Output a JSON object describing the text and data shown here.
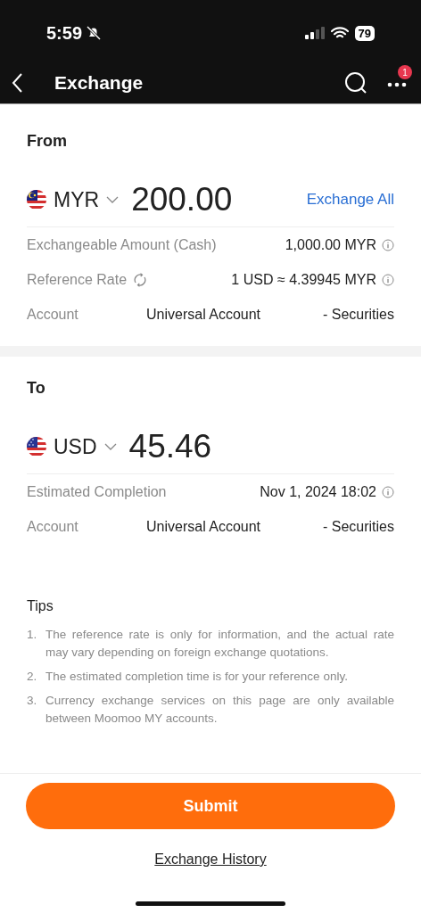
{
  "status_bar": {
    "time": "5:59",
    "battery": "79"
  },
  "nav": {
    "title": "Exchange",
    "badge": "1"
  },
  "sections": [
    {
      "heading": "From",
      "currency": "MYR",
      "kind": "malaysia",
      "amount": "200.00",
      "action": "Exchange All",
      "rows": [
        {
          "kind": "info",
          "label": "Exchangeable Amount (Cash)",
          "value": "1,000.00 MYR",
          "refresh": false,
          "info": true
        },
        {
          "kind": "info",
          "label": "Reference Rate",
          "value": "1 USD ≈ 4.39945 MYR",
          "refresh": true,
          "info": true
        },
        {
          "kind": "account",
          "label": "Account",
          "name": "Universal Account",
          "type": "- Securities"
        }
      ]
    },
    {
      "heading": "To",
      "currency": "USD",
      "kind": "usa",
      "amount": "45.46",
      "rows": [
        {
          "kind": "info",
          "label": "Estimated Completion",
          "value": "Nov 1, 2024 18:02",
          "refresh": false,
          "info": true
        },
        {
          "kind": "account",
          "label": "Account",
          "name": "Universal Account",
          "type": "- Securities"
        }
      ]
    }
  ],
  "tips": {
    "title": "Tips",
    "items": [
      {
        "number": "1.",
        "text": "The reference rate is only for information, and the actual rate may vary depending on foreign exchange quotations."
      },
      {
        "number": "2.",
        "text": "The estimated completion time is for your reference only."
      },
      {
        "number": "3.",
        "text": "Currency exchange services on this page are only available between Moomoo MY accounts."
      }
    ]
  },
  "submit": "Submit",
  "history_link": "Exchange History"
}
